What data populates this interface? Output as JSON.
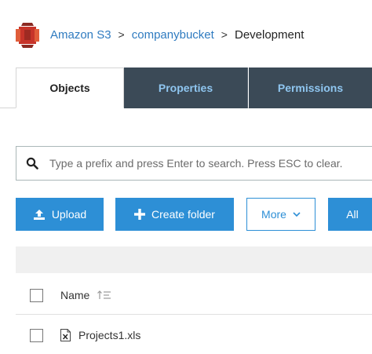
{
  "colors": {
    "link": "#2f7bc0",
    "primary_button": "#2d8fd6",
    "tab_dark_bg": "#3b4a57",
    "tab_dark_text": "#8fc6f0",
    "logo": "#c7342a"
  },
  "breadcrumb": {
    "logo_icon": "aws-s3-bucket-icon",
    "items": [
      "Amazon S3",
      "companybucket",
      "Development"
    ],
    "separator": ">"
  },
  "tabs": [
    {
      "label": "Objects",
      "active": true
    },
    {
      "label": "Properties",
      "active": false
    },
    {
      "label": "Permissions",
      "active": false
    }
  ],
  "search": {
    "icon": "search-icon",
    "placeholder": "Type a prefix and press Enter to search. Press ESC to clear.",
    "value": ""
  },
  "toolbar": {
    "upload_label": "Upload",
    "create_folder_label": "Create folder",
    "more_label": "More",
    "all_label": "All"
  },
  "table": {
    "columns": [
      {
        "label": "Name",
        "sortable": true
      }
    ],
    "rows": [
      {
        "name": "Projects1.xls",
        "icon": "excel-file-icon",
        "selected": false
      }
    ]
  }
}
